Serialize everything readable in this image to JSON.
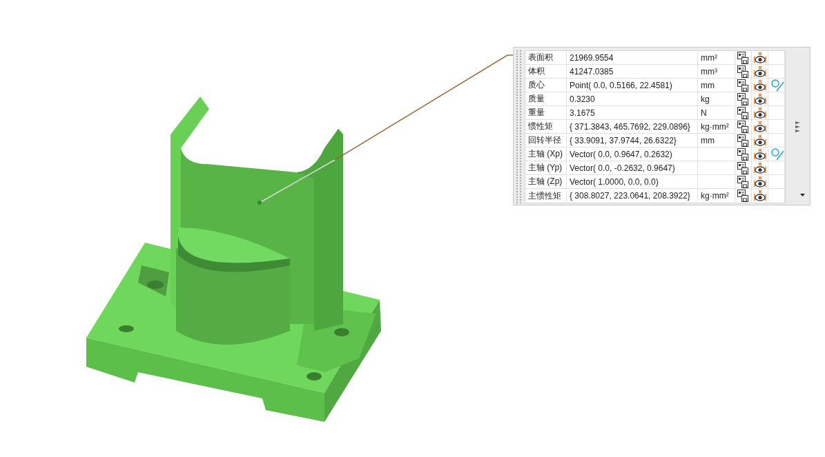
{
  "properties_table": {
    "rows": [
      {
        "label": "表面积",
        "value": "21969.9554",
        "unit": "mm²",
        "locate": false
      },
      {
        "label": "体积",
        "value": "41247.0385",
        "unit": "mm³",
        "locate": false
      },
      {
        "label": "质心",
        "value": "Point( 0.0, 0.5166, 22.4581)",
        "unit": "mm",
        "locate": true
      },
      {
        "label": "质量",
        "value": "0.3230",
        "unit": "kg",
        "locate": false
      },
      {
        "label": "重量",
        "value": "3.1675",
        "unit": "N",
        "locate": false
      },
      {
        "label": "惯性矩",
        "value": "{ 371.3843, 465.7692, 229.0896}",
        "unit": "kg·mm²",
        "locate": false
      },
      {
        "label": "回转半径",
        "value": "{ 33.9091, 37.9744, 26.6322}",
        "unit": "mm",
        "locate": false
      },
      {
        "label": "主轴 (Xp)",
        "value": "Vector( 0.0, 0.9647, 0.2632)",
        "locate": true
      },
      {
        "label": "主轴 (Yp)",
        "value": "Vector( 0.0, -0.2632, 0.9647)",
        "locate": false
      },
      {
        "label": "主轴 (Zp)",
        "value": "Vector( 1.0000, 0.0, 0.0)",
        "locate": false
      },
      {
        "label": "主惯性矩",
        "value": "{ 308.8027, 223.0641, 208.3922}",
        "unit": "kg·mm²",
        "locate": false
      }
    ]
  }
}
